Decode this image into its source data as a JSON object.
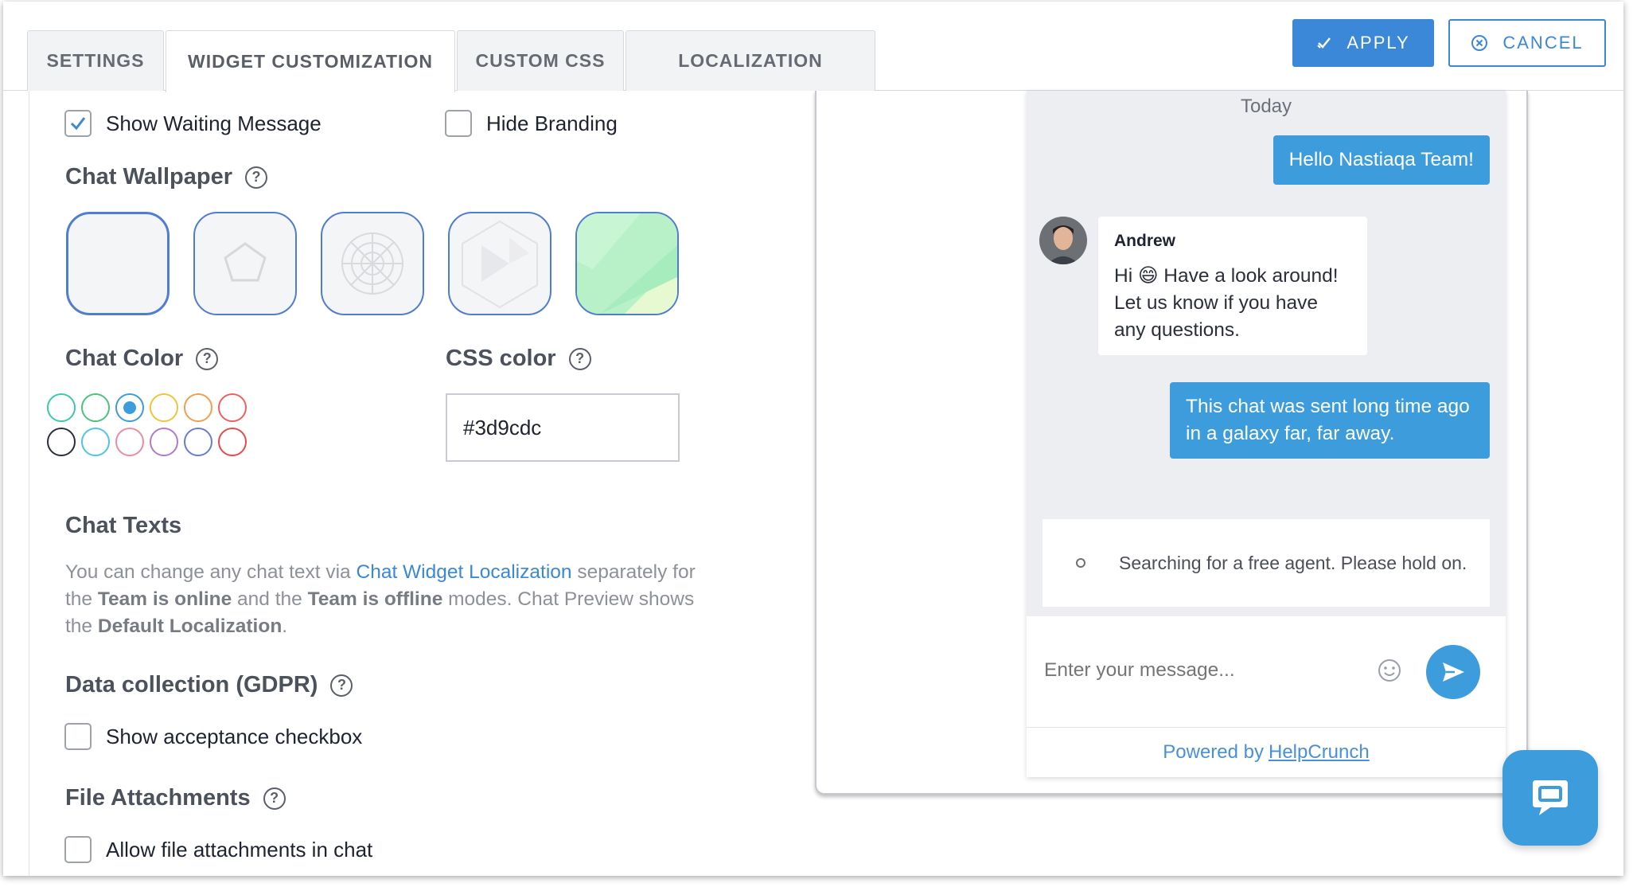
{
  "tabs": [
    {
      "label": "SETTINGS"
    },
    {
      "label": "WIDGET CUSTOMIZATION"
    },
    {
      "label": "CUSTOM CSS"
    },
    {
      "label": "LOCALIZATION"
    }
  ],
  "actions": {
    "apply": "APPLY",
    "cancel": "CANCEL"
  },
  "options": {
    "show_waiting_message": {
      "label": "Show Waiting Message",
      "checked": true
    },
    "hide_branding": {
      "label": "Hide Branding",
      "checked": false
    }
  },
  "wallpaper": {
    "title": "Chat Wallpaper",
    "selected_index": 0
  },
  "chat_color": {
    "title": "Chat Color",
    "swatches_row1": [
      "#3dc9a8",
      "#4cc47a",
      "#3d9cdc",
      "#f0c43c",
      "#f0a050",
      "#f06060"
    ],
    "swatches_row2": [
      "#2a2f3a",
      "#4cc6e8",
      "#f08aa0",
      "#b07ad0",
      "#6a7ad8",
      "#e84a4a"
    ],
    "selected": "#3d9cdc"
  },
  "css_color": {
    "title": "CSS color",
    "value": "#3d9cdc"
  },
  "chat_texts": {
    "title": "Chat Texts",
    "p1": "You can change any chat text via ",
    "link": "Chat Widget Localization",
    "p2": " separately for the ",
    "b1": "Team is online",
    "p3": " and the ",
    "b2": "Team is offline",
    "p4": " modes. Chat Preview shows the ",
    "b3": "Default Localization",
    "p5": "."
  },
  "gdpr": {
    "title": "Data collection (GDPR)",
    "checkbox": "Show acceptance checkbox"
  },
  "attachments": {
    "title": "File Attachments",
    "checkbox": "Allow file attachments in chat"
  },
  "preview": {
    "today": "Today",
    "msg_out1": "Hello Nastiaqa Team!",
    "agent_name": "Andrew",
    "msg_in_a": "Hi ",
    "msg_in_emoji": "😄",
    "msg_in_b": "  Have a look around! Let us know if you have any questions.",
    "msg_out2": "This chat was sent long time ago in a galaxy far, far away.",
    "searching": "Searching for a free agent. Please hold on.",
    "input_placeholder": "Enter your message...",
    "powered_by": "Powered by",
    "brand": "HelpCrunch"
  }
}
